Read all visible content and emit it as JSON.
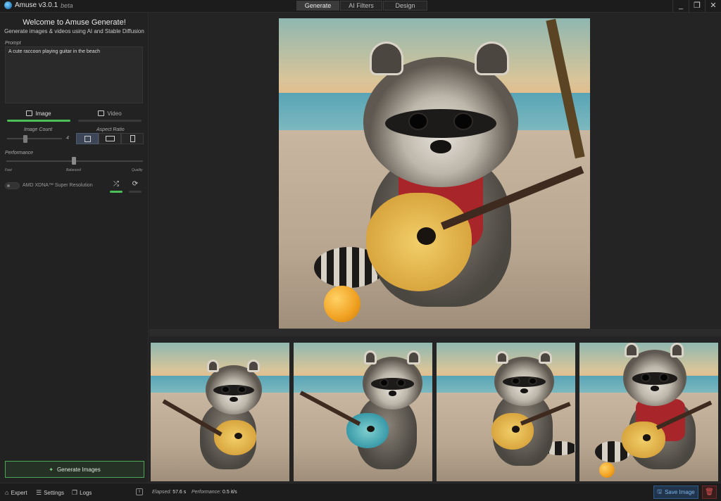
{
  "titlebar": {
    "app_name": "Amuse v3.0.1",
    "app_tag": "beta",
    "tabs": [
      "Generate",
      "AI Filters",
      "Design"
    ],
    "active_tab": "Generate",
    "controls": [
      "_",
      "❐",
      "✕"
    ]
  },
  "sidebar": {
    "welcome_title": "Welcome to Amuse Generate!",
    "welcome_subtitle": "Generate images & videos using AI and Stable Diffusion",
    "prompt_label": "Prompt",
    "prompt_value": "A cute raccoon playing guitar in the beach",
    "mode_tabs": [
      {
        "label": "Image",
        "active": true,
        "icon": "image-icon"
      },
      {
        "label": "Video",
        "active": false,
        "icon": "film-icon"
      }
    ],
    "image_count_label": "Image Count",
    "image_count_value": "4",
    "aspect_ratio_label": "Aspect Ratio",
    "aspect_options": [
      "square",
      "landscape",
      "portrait"
    ],
    "aspect_selected": "square",
    "performance_label": "Performance",
    "performance_ticks": [
      "Fast",
      "Balanced",
      "Quality"
    ],
    "performance_value": "Balanced",
    "super_resolution_label": "AMD XDNA™ Super Resolution",
    "super_resolution_enabled": false,
    "shuffle_icon": "shuffle-icon",
    "repeat_icon": "repeat-icon",
    "generate_button": "Generate Images"
  },
  "main": {
    "preview_alt": "raccoon playing guitar on beach",
    "thumbnail_count": 4
  },
  "statusbar": {
    "expert_label": "Expert",
    "settings_label": "Settings",
    "logs_label": "Logs",
    "elapsed_label": "Elapsed:",
    "elapsed_value": "57.6 s",
    "performance_label": "Performance:",
    "performance_value": "0.5 it/s",
    "save_button": "Save Image"
  },
  "colors": {
    "accent_green": "#4cbf59",
    "accent_blue": "#2f5b8a",
    "danger_red": "#e05555",
    "background": "#1f1f1f"
  }
}
